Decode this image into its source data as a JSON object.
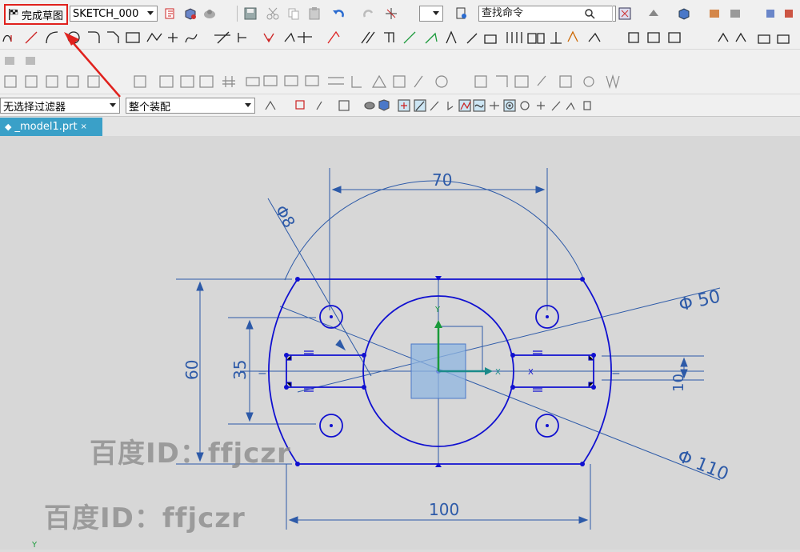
{
  "toolbar": {
    "finish_sketch_label": "完成草图",
    "sketch_name": "SKETCH_000",
    "search_placeholder": "查找命令",
    "selection_filter": "无选择过滤器",
    "assembly_scope": "整个装配"
  },
  "tab": {
    "label": "_model1.prt",
    "close_glyph": "×"
  },
  "drawing": {
    "dim_70": "70",
    "dim_phi8": "Φ8",
    "dim_phi50": "Φ 50",
    "dim_60": "60",
    "dim_35": "35",
    "dim_10": "10",
    "dim_phi110": "Φ 110",
    "dim_100": "100",
    "axis_x": "X",
    "axis_y": "Y",
    "constraint_equal": "="
  },
  "watermark": {
    "line1": "百度ID：ffjczr",
    "line2": "百度ID：ffjczr"
  },
  "colors": {
    "sketch_blue": "#1010d0",
    "dimension_blue": "#2d5aa8",
    "highlight_red": "#e0211d",
    "tab_blue": "#3aa0c8",
    "csys_green": "#1a9a3a",
    "csys_teal": "#1a8a8a"
  },
  "icons": [
    "flag-icon",
    "save-icon",
    "cut-icon",
    "copy-icon",
    "paste-icon",
    "undo-icon",
    "redo-icon",
    "search-icon",
    "line-icon",
    "arc-icon",
    "circle-icon",
    "rectangle-icon",
    "fillet-icon",
    "trim-icon",
    "dimension-icon",
    "constraint-icon",
    "fit-view-icon",
    "shaded-view-icon"
  ]
}
